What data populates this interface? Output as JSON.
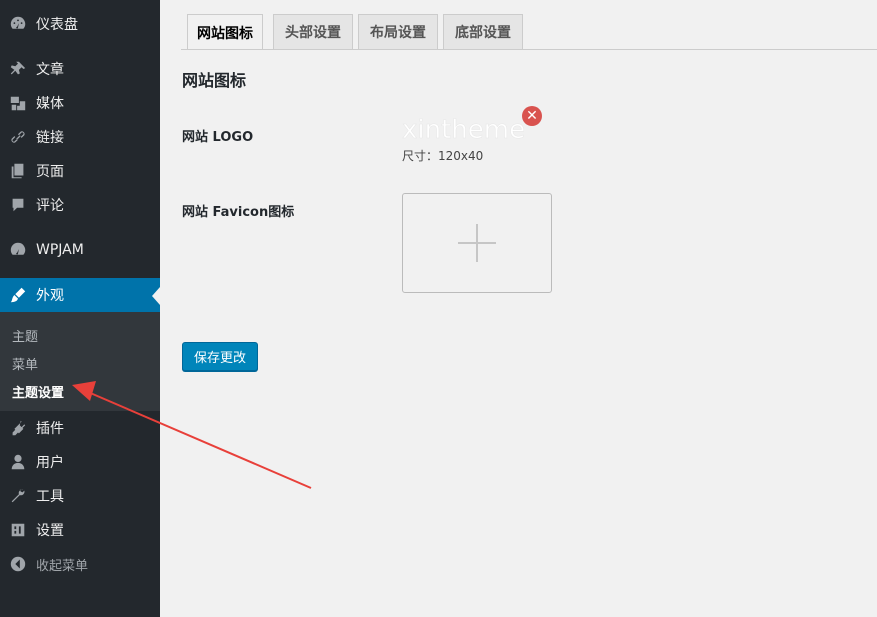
{
  "sidebar": {
    "items": [
      {
        "label": "仪表盘",
        "icon": "dashboard-icon"
      },
      {
        "label": "文章",
        "icon": "pin-icon"
      },
      {
        "label": "媒体",
        "icon": "media-icon"
      },
      {
        "label": "链接",
        "icon": "link-icon"
      },
      {
        "label": "页面",
        "icon": "page-icon"
      },
      {
        "label": "评论",
        "icon": "comment-icon"
      },
      {
        "label": "WPJAM",
        "icon": "wpjam-icon"
      },
      {
        "label": "外观",
        "icon": "brush-icon"
      },
      {
        "label": "插件",
        "icon": "plugin-icon"
      },
      {
        "label": "用户",
        "icon": "user-icon"
      },
      {
        "label": "工具",
        "icon": "wrench-icon"
      },
      {
        "label": "设置",
        "icon": "settings-icon"
      },
      {
        "label": "收起菜单",
        "icon": "collapse-icon"
      }
    ],
    "submenu": [
      "主题",
      "菜单",
      "主题设置"
    ],
    "active_color": "#0073aa"
  },
  "tabs": [
    "网站图标",
    "头部设置",
    "布局设置",
    "底部设置"
  ],
  "section_title": "网站图标",
  "fields": {
    "logo_label": "网站 LOGO",
    "logo_text": "xintheme",
    "logo_size": "尺寸：120x40",
    "favicon_label": "网站 Favicon图标"
  },
  "save_label": "保存更改"
}
